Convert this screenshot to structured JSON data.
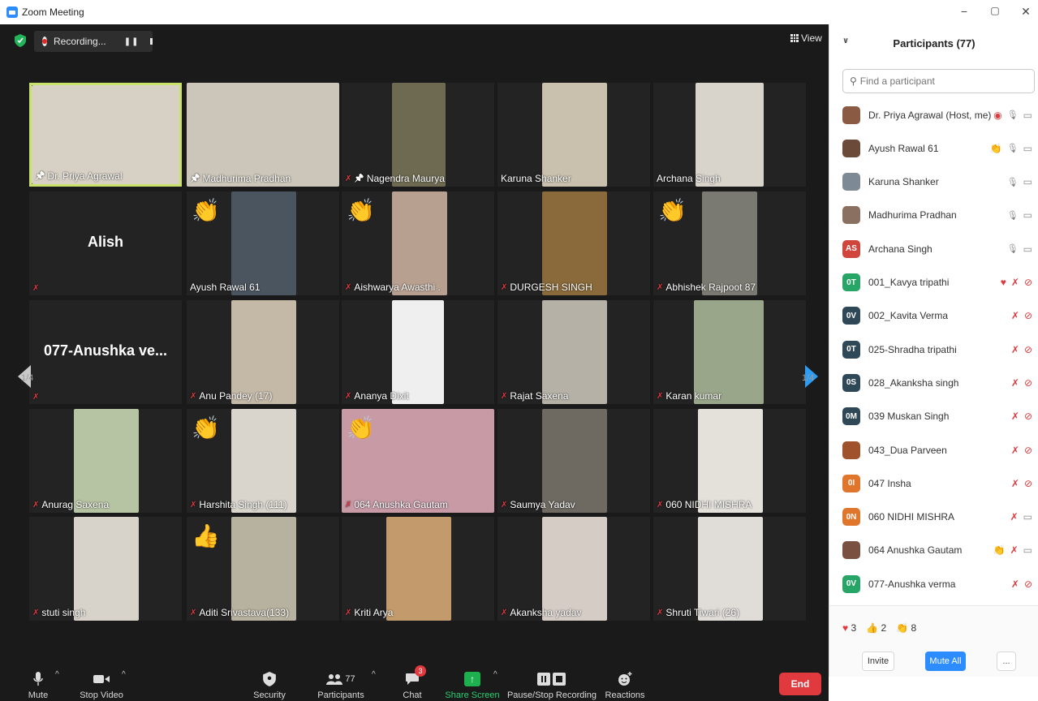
{
  "window": {
    "title": "Zoom Meeting",
    "minimize": "−",
    "restore": "▢",
    "close": "✕"
  },
  "topbar": {
    "recording_label": "Recording...",
    "pause": "❚❚",
    "view_label": "View"
  },
  "tiles": [
    {
      "name": "Dr. Priya Agrawal",
      "pinned": true,
      "muted": false,
      "active": true,
      "bg": "#d7d0c4"
    },
    {
      "name": "Madhurima Pradhan",
      "pinned": true,
      "muted": false,
      "bg": "#cbc6b9"
    },
    {
      "name": "Nagendra Maurya",
      "pinned": true,
      "muted": true,
      "bg": "#6e6a52"
    },
    {
      "name": "Karuna Shanker",
      "muted": false,
      "bg": "#c9c0ad"
    },
    {
      "name": "Archana Singh",
      "muted": false,
      "bg": "#d8d4cc"
    },
    {
      "bigname": "Alish",
      "name": "",
      "muted": true
    },
    {
      "name": "Ayush Rawal 61",
      "muted": false,
      "reaction": "👏",
      "bg": "#4b5560"
    },
    {
      "name": "Aishwarya Awasthi .",
      "muted": true,
      "reaction": "👏",
      "bg": "#b8a091"
    },
    {
      "name": "DURGESH SINGH",
      "muted": true,
      "bg": "#8a6a3a"
    },
    {
      "name": "Abhishek Rajpoot 87",
      "muted": true,
      "reaction": "👏",
      "bg": "#7b7a72"
    },
    {
      "bigname": "077-Anushka ve...",
      "name": "",
      "muted": true
    },
    {
      "name": "Anu Pandey (17)",
      "muted": true,
      "bg": "#c4b8a7"
    },
    {
      "name": "Ananya Dixit",
      "muted": true,
      "bg": "#efefef"
    },
    {
      "name": "Rajat Saxena",
      "muted": true,
      "bg": "#b6b1a6"
    },
    {
      "name": "Karan kumar",
      "muted": true,
      "bg": "#9aa68a"
    },
    {
      "name": "Anurag Saxena",
      "muted": true,
      "bg": "#b7c4a3"
    },
    {
      "name": "Harshita Singh (111)",
      "muted": true,
      "reaction": "👏",
      "bg": "#d9d5cd"
    },
    {
      "name": "064 Anushka Gautam",
      "muted": true,
      "reaction": "👏",
      "bg": "#c79aa6"
    },
    {
      "name": "Saumya Yadav",
      "muted": true,
      "bg": "#6e6a62"
    },
    {
      "name": "060 NIDHI MISHRA",
      "muted": true,
      "bg": "#e4e1db"
    },
    {
      "name": "stuti singh",
      "muted": true,
      "bg": "#d8d3ca"
    },
    {
      "name": "Aditi Srivastava(133)",
      "muted": true,
      "reaction": "👍",
      "bg": "#b7b19f"
    },
    {
      "name": "Kriti Arya",
      "muted": true,
      "bg": "#c39a6c"
    },
    {
      "name": "Akanksha yadav",
      "muted": true,
      "bg": "#d6ccc6"
    },
    {
      "name": "Shruti Tiwari (26)",
      "muted": true,
      "bg": "#e0ddd8"
    }
  ],
  "pager": {
    "left": "1/4",
    "right": "1/4"
  },
  "toolbar": {
    "mute": "Mute",
    "stop_video": "Stop Video",
    "security": "Security",
    "participants": "Participants",
    "participants_count": "77",
    "chat": "Chat",
    "chat_badge": "3",
    "share_screen": "Share Screen",
    "pause_recording": "Pause/Stop Recording",
    "reactions": "Reactions",
    "end": "End"
  },
  "panel": {
    "title": "Participants (77)",
    "search_placeholder": "Find a participant",
    "participants": [
      {
        "name": "Dr. Priya Agrawal (Host, me)",
        "avatar_color": "#8b5a43",
        "initials": "",
        "status": "record",
        "mic": "on",
        "cam": "on"
      },
      {
        "name": "Ayush Rawal 61",
        "avatar_color": "#6b4a3a",
        "initials": "",
        "status": "wave",
        "mic": "on",
        "cam": "on"
      },
      {
        "name": "Karuna Shanker",
        "avatar_color": "#7d8a95",
        "initials": "",
        "mic": "on",
        "cam": "on"
      },
      {
        "name": "Madhurima Pradhan",
        "avatar_color": "#8a7060",
        "initials": "",
        "mic": "on",
        "cam": "on"
      },
      {
        "name": "Archana Singh",
        "avatar_color": "#d0453c",
        "initials": "AS",
        "mic": "on",
        "cam": "on"
      },
      {
        "name": "001_Kavya tripathi",
        "avatar_color": "#27a567",
        "initials": "0T",
        "status": "heart",
        "mic": "off",
        "cam": "off"
      },
      {
        "name": "002_Kavita Verma",
        "avatar_color": "#2f4858",
        "initials": "0V",
        "mic": "off",
        "cam": "off"
      },
      {
        "name": "025-Shradha tripathi",
        "avatar_color": "#2f4858",
        "initials": "0T",
        "mic": "off",
        "cam": "off"
      },
      {
        "name": "028_Akanksha singh",
        "avatar_color": "#2f4858",
        "initials": "0S",
        "mic": "off",
        "cam": "off"
      },
      {
        "name": "039 Muskan Singh",
        "avatar_color": "#2f4858",
        "initials": "0M",
        "mic": "off",
        "cam": "off"
      },
      {
        "name": "043_Dua Parveen",
        "avatar_color": "#a0522d",
        "initials": "",
        "mic": "off",
        "cam": "off"
      },
      {
        "name": "047 Insha",
        "avatar_color": "#e0762b",
        "initials": "0I",
        "mic": "off",
        "cam": "off"
      },
      {
        "name": "060 NIDHI MISHRA",
        "avatar_color": "#e0762b",
        "initials": "0N",
        "mic": "off",
        "cam": "on"
      },
      {
        "name": "064 Anushka Gautam",
        "avatar_color": "#7a5040",
        "initials": "",
        "status": "wave",
        "mic": "off",
        "cam": "on"
      },
      {
        "name": "077-Anushka verma",
        "avatar_color": "#27a567",
        "initials": "0V",
        "mic": "off",
        "cam": "off"
      }
    ],
    "reaction_summary": {
      "heart": "3",
      "thumbs": "2",
      "clap": "8"
    },
    "invite": "Invite",
    "mute_all": "Mute All",
    "more": "..."
  }
}
